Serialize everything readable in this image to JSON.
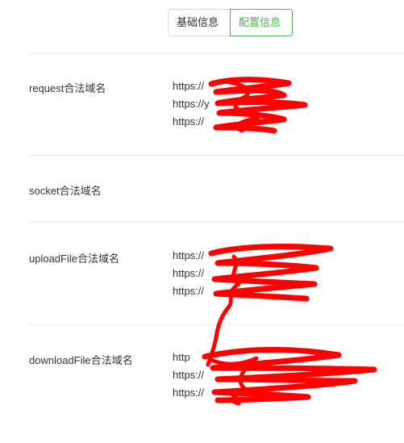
{
  "tabs": [
    {
      "label": "基础信息",
      "active": false
    },
    {
      "label": "配置信息",
      "active": true
    }
  ],
  "colors": {
    "accent": "#4fb04f",
    "text": "#333333",
    "divider": "#ebebeb",
    "redaction": "#ff0000"
  },
  "sections": [
    {
      "label": "request合法域名",
      "domains": [
        "https://",
        "https://y",
        "https://"
      ]
    },
    {
      "label": "socket合法域名",
      "domains": []
    },
    {
      "label": "uploadFile合法域名",
      "domains": [
        "https://",
        "https://",
        "https://"
      ]
    },
    {
      "label": "downloadFile合法域名",
      "domains": [
        "http",
        "https://",
        "https://"
      ]
    }
  ]
}
